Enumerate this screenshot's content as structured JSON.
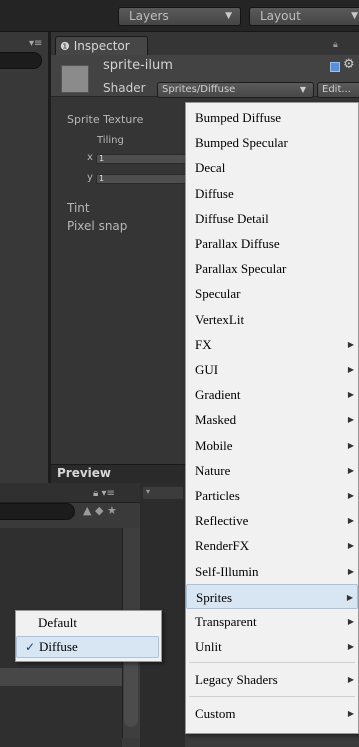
{
  "toolbar": {
    "layers_label": "Layers",
    "layout_label": "Layout"
  },
  "inspector": {
    "tab_title": "Inspector",
    "material_name": "sprite-ilum",
    "shader_label": "Shader",
    "shader_value": "Sprites/Diffuse",
    "edit_label": "Edit...",
    "properties": {
      "sprite_texture": "Sprite Texture",
      "tiling": "Tiling",
      "x_label": "x",
      "x_value": "1",
      "y_label": "y",
      "y_value": "1",
      "tint": "Tint",
      "pixel_snap": "Pixel snap"
    },
    "preview_label": "Preview"
  },
  "shader_menu": {
    "items": [
      {
        "label": "Bumped Diffuse",
        "submenu": false
      },
      {
        "label": "Bumped Specular",
        "submenu": false
      },
      {
        "label": "Decal",
        "submenu": false
      },
      {
        "label": "Diffuse",
        "submenu": false
      },
      {
        "label": "Diffuse Detail",
        "submenu": false
      },
      {
        "label": "Parallax Diffuse",
        "submenu": false
      },
      {
        "label": "Parallax Specular",
        "submenu": false
      },
      {
        "label": "Specular",
        "submenu": false
      },
      {
        "label": "VertexLit",
        "submenu": false
      },
      {
        "label": "FX",
        "submenu": true
      },
      {
        "label": "GUI",
        "submenu": true
      },
      {
        "label": "Gradient",
        "submenu": true
      },
      {
        "label": "Masked",
        "submenu": true
      },
      {
        "label": "Mobile",
        "submenu": true
      },
      {
        "label": "Nature",
        "submenu": true
      },
      {
        "label": "Particles",
        "submenu": true
      },
      {
        "label": "Reflective",
        "submenu": true
      },
      {
        "label": "RenderFX",
        "submenu": true
      },
      {
        "label": "Self-Illumin",
        "submenu": true
      },
      {
        "label": "Sprites",
        "submenu": true,
        "highlighted": true
      },
      {
        "label": "Transparent",
        "submenu": true
      },
      {
        "label": "Unlit",
        "submenu": true
      },
      {
        "label": "Legacy Shaders",
        "submenu": true
      },
      {
        "label": "Custom",
        "submenu": true
      }
    ]
  },
  "sprites_submenu": {
    "items": [
      {
        "label": "Default",
        "checked": false
      },
      {
        "label": "Diffuse",
        "checked": true
      }
    ]
  },
  "icons": {
    "check": "✓",
    "submenu_arrow": "▶",
    "dropdown": "▼",
    "info": "info-icon",
    "lock": "lock-icon",
    "gear": "gear-icon"
  },
  "colors": {
    "menu_bg": "#f1f1f1",
    "menu_highlight": "#d8e6f4",
    "panel_bg": "#353535"
  }
}
